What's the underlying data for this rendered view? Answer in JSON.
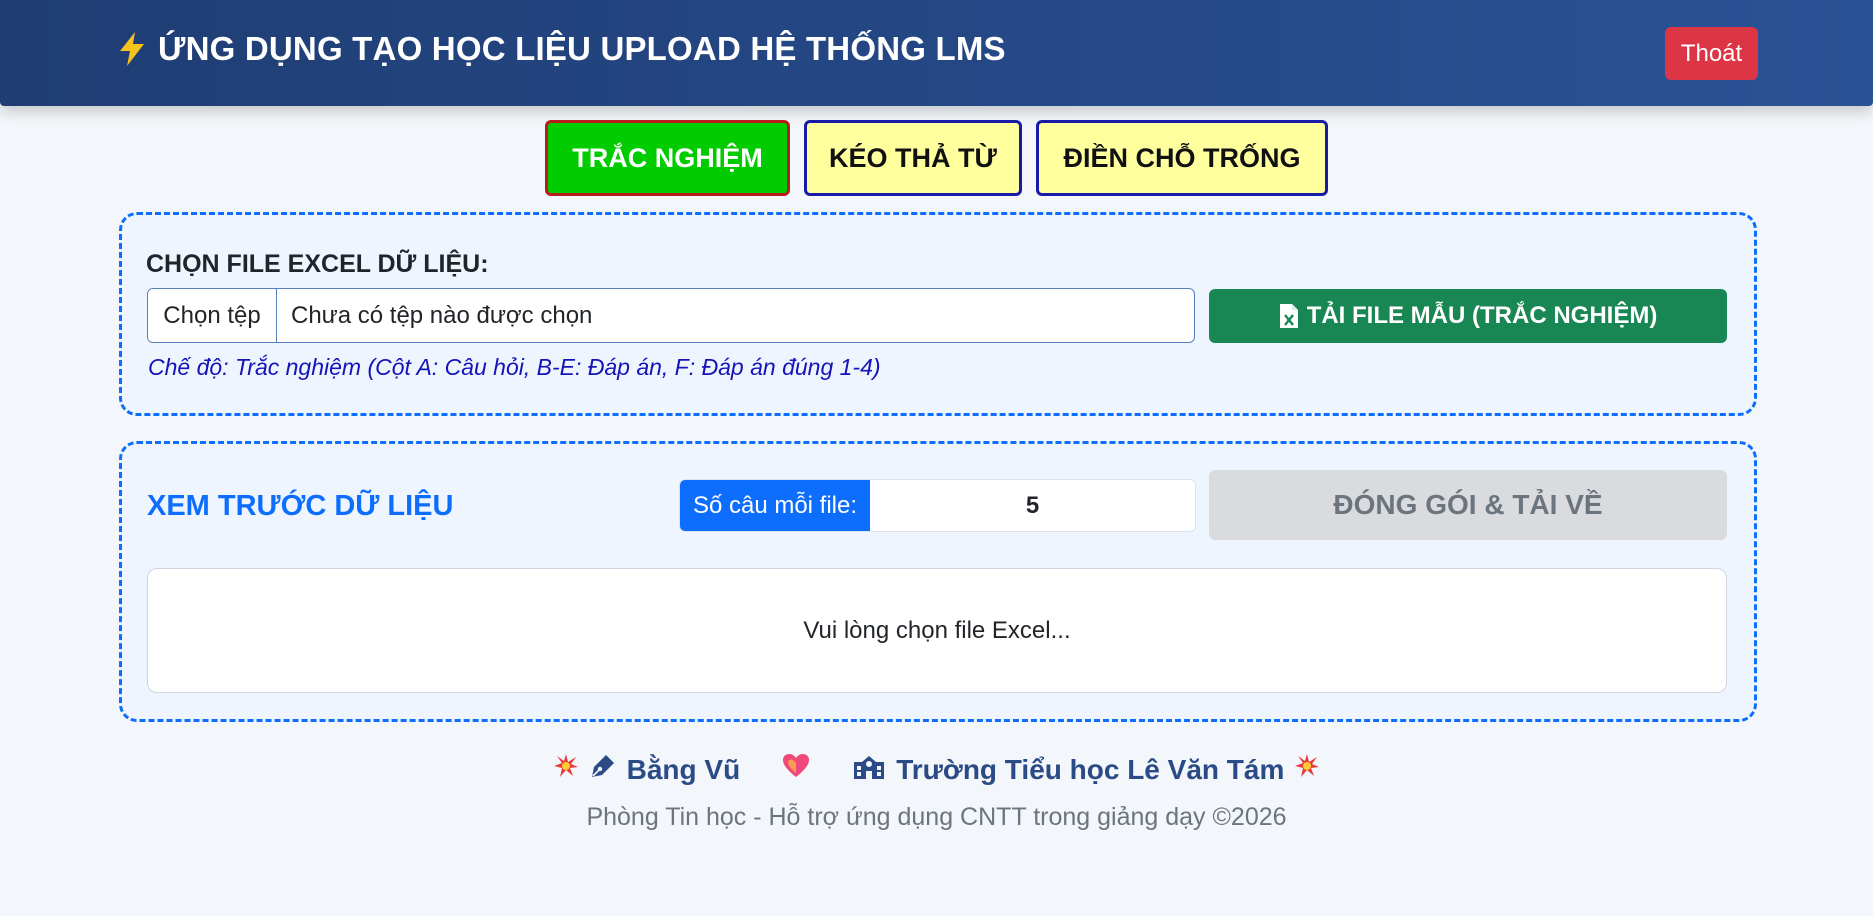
{
  "header": {
    "title": "ỨNG DỤNG TẠO HỌC LIỆU UPLOAD HỆ THỐNG LMS",
    "logout_label": "Thoát"
  },
  "tabs": [
    {
      "label": "TRẮC NGHIỆM",
      "active": true
    },
    {
      "label": "KÉO THẢ TỪ",
      "active": false
    },
    {
      "label": "ĐIỀN CHỖ TRỐNG",
      "active": false
    }
  ],
  "upload": {
    "label": "CHỌN FILE EXCEL DỮ LIỆU:",
    "choose_button": "Chọn tệp",
    "file_status": "Chưa có tệp nào được chọn",
    "template_button": "TẢI FILE MẪU (TRẮC NGHIỆM)",
    "mode_hint": "Chế độ: Trắc nghiệm (Cột A: Câu hỏi, B-E: Đáp án, F: Đáp án đúng 1-4)"
  },
  "preview": {
    "title": "XEM TRƯỚC DỮ LIỆU",
    "count_label": "Số câu mỗi file:",
    "count_value": "5",
    "pack_button": "ĐÓNG GÓI & TẢI VỀ",
    "placeholder": "Vui lòng chọn file Excel..."
  },
  "footer": {
    "author": "Bằng Vũ",
    "school": "Trường Tiểu học Lê Văn Tám",
    "subtitle": "Phòng Tin học - Hỗ trợ ứng dụng CNTT trong giảng dạy ©2026"
  },
  "colors": {
    "header_start": "#1f3d73",
    "header_end": "#2a5296",
    "active_tab": "#00cc00",
    "inactive_tab": "#ffff9e",
    "primary": "#0d6efd",
    "success": "#198754",
    "danger": "#dc3545"
  },
  "icons": [
    "bolt-icon",
    "file-excel-icon",
    "explosion-icon",
    "pen-nib-icon",
    "heart-icon",
    "school-icon"
  ]
}
